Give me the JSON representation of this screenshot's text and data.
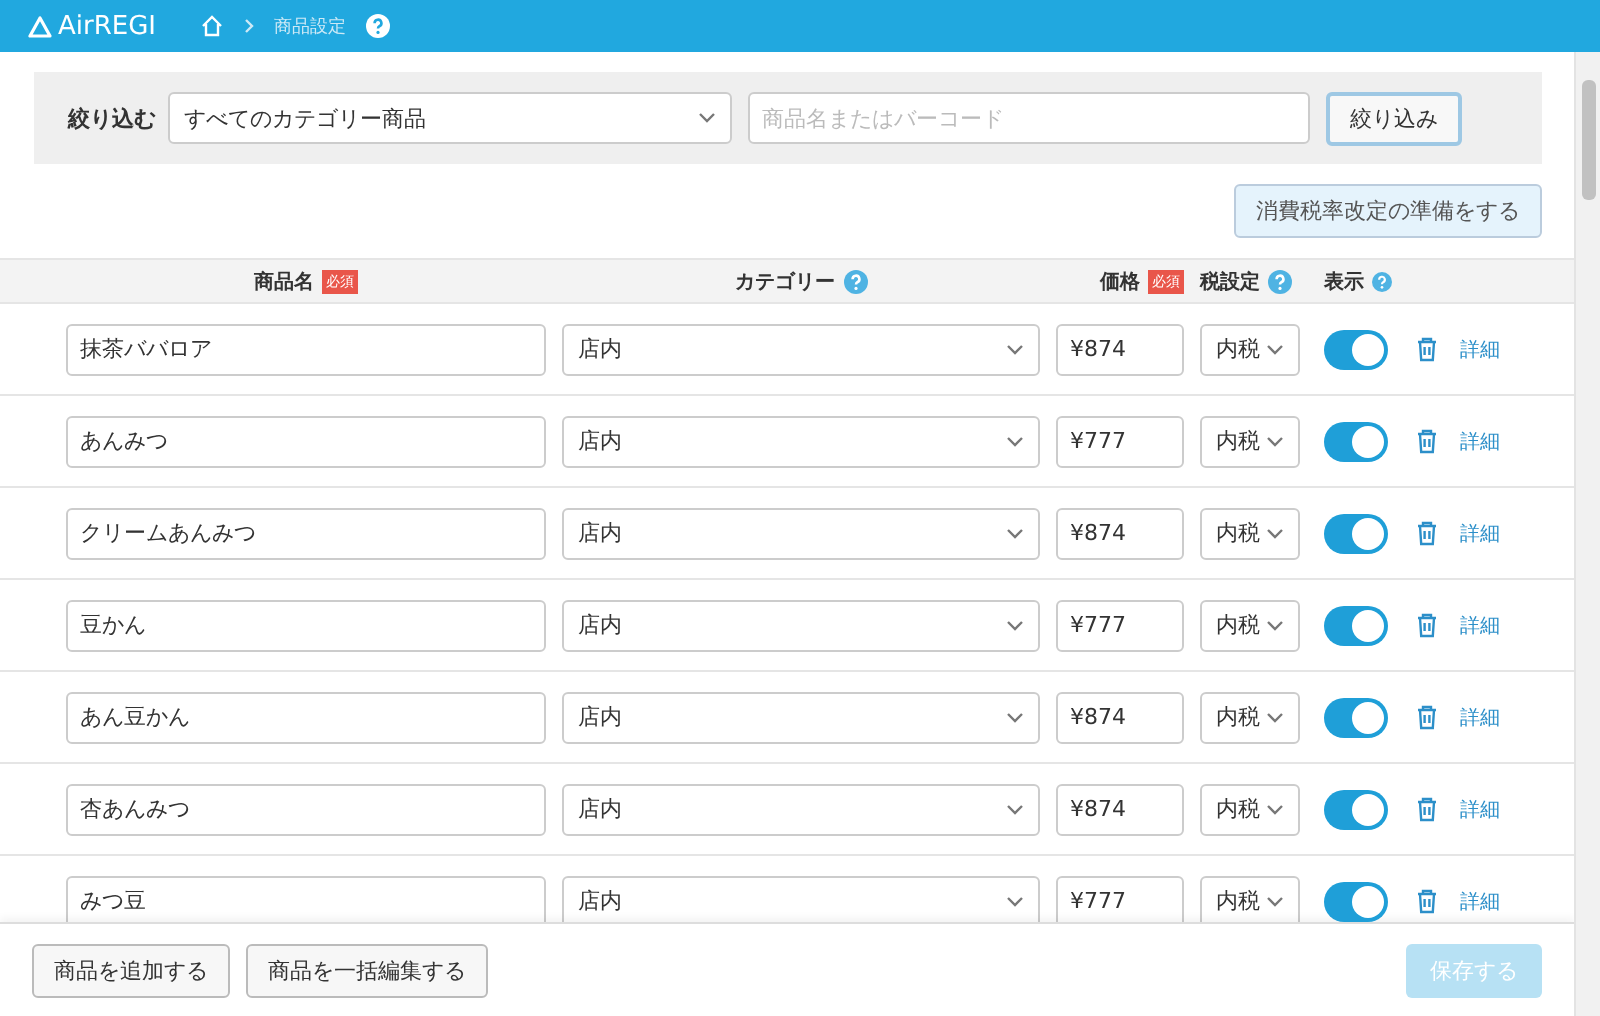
{
  "header": {
    "logo": "AirREGI",
    "breadcrumb": "商品設定"
  },
  "filter": {
    "label": "絞り込む",
    "category": "すべてのカテゴリー商品",
    "search_placeholder": "商品名またはバーコード",
    "button": "絞り込み"
  },
  "tax_prep_button": "消費税率改定の準備をする",
  "table": {
    "columns": [
      {
        "label": "商品名",
        "badge": "必須",
        "help": false
      },
      {
        "label": "カテゴリー",
        "help": true
      },
      {
        "label": "価格",
        "badge": "必須",
        "help": false
      },
      {
        "label": "税設定",
        "help": true
      },
      {
        "label": "表示",
        "help": true
      }
    ],
    "rows": [
      {
        "name": "抹茶ババロア",
        "category": "店内",
        "price": "¥874",
        "tax": "内税",
        "shown": true,
        "detail": "詳細"
      },
      {
        "name": "あんみつ",
        "category": "店内",
        "price": "¥777",
        "tax": "内税",
        "shown": true,
        "detail": "詳細"
      },
      {
        "name": "クリームあんみつ",
        "category": "店内",
        "price": "¥874",
        "tax": "内税",
        "shown": true,
        "detail": "詳細"
      },
      {
        "name": "豆かん",
        "category": "店内",
        "price": "¥777",
        "tax": "内税",
        "shown": true,
        "detail": "詳細"
      },
      {
        "name": "あん豆かん",
        "category": "店内",
        "price": "¥874",
        "tax": "内税",
        "shown": true,
        "detail": "詳細"
      },
      {
        "name": "杏あんみつ",
        "category": "店内",
        "price": "¥874",
        "tax": "内税",
        "shown": true,
        "detail": "詳細"
      },
      {
        "name": "みつ豆",
        "category": "店内",
        "price": "¥777",
        "tax": "内税",
        "shown": true,
        "detail": "詳細"
      }
    ]
  },
  "footer": {
    "buttons": [
      "商品を追加する",
      "商品を一括編集する"
    ],
    "save": {
      "label": "保存する",
      "disabled": true
    }
  }
}
